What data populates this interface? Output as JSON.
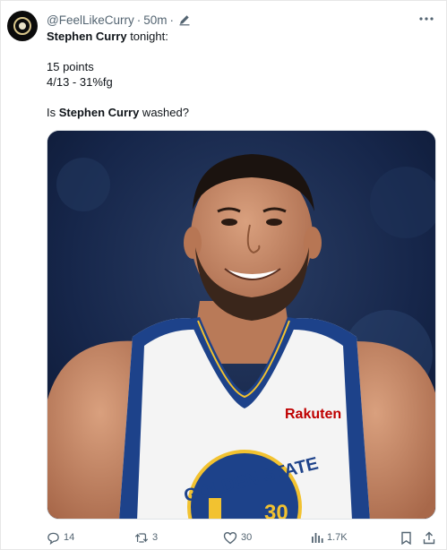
{
  "author": {
    "handle": "@FeelLikeCurry",
    "time": "50m",
    "avatar_icon": "user-avatar"
  },
  "tweet": {
    "line1_bold": "Stephen Curry",
    "line1_rest": " tonight:",
    "line2": "15 points",
    "line3": "4/13 - 31%fg",
    "line4_pre": "Is ",
    "line4_bold": "Stephen Curry",
    "line4_post": " washed?"
  },
  "media": {
    "jersey_brand": "Rakuten",
    "jersey_team": "GOLDEN STATE",
    "jersey_number": "30",
    "colors": {
      "jersey_blue": "#1d428a",
      "jersey_gold": "#f2c230",
      "background": "#13213f"
    }
  },
  "actions": {
    "replies": "14",
    "reposts": "3",
    "likes": "30",
    "views": "1.7K"
  },
  "icons": [
    "edit-icon",
    "more-icon",
    "reply-icon",
    "repost-icon",
    "like-icon",
    "views-icon",
    "bookmark-icon",
    "share-icon"
  ]
}
